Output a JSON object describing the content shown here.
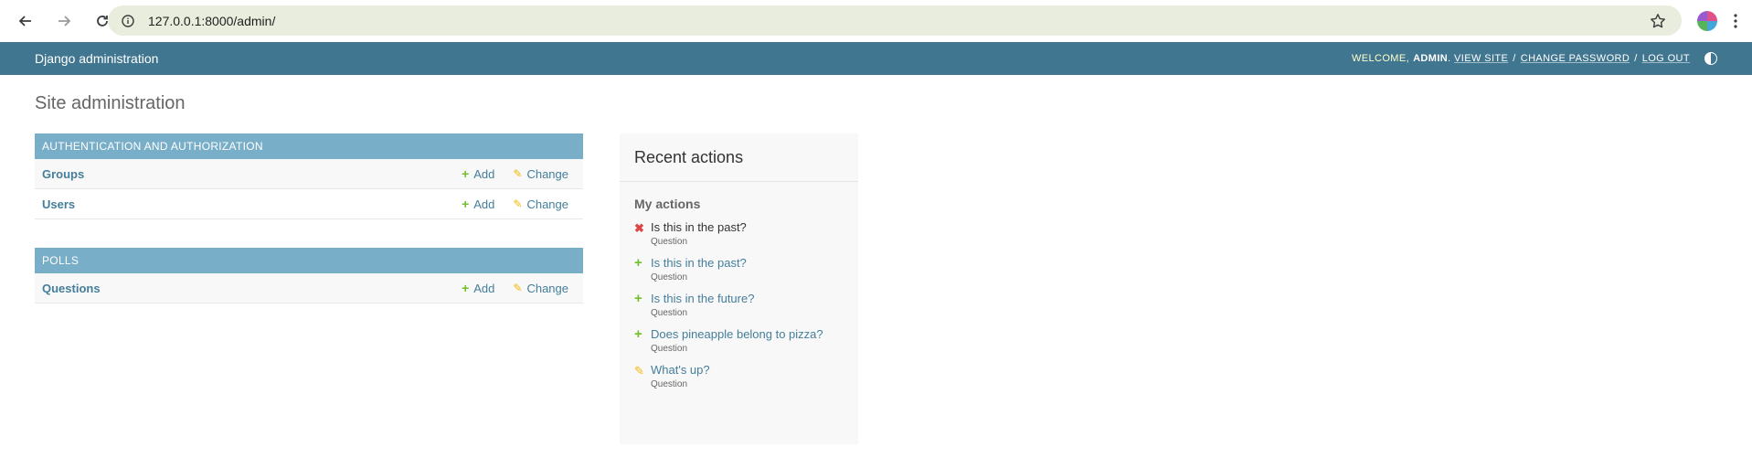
{
  "browser": {
    "url": "127.0.0.1:8000/admin/"
  },
  "header": {
    "branding": "Django administration",
    "welcome": "Welcome,",
    "username": "admin",
    "view_site": "View site",
    "change_password": "Change password",
    "log_out": "Log out"
  },
  "page_title": "Site administration",
  "modules": [
    {
      "caption": "Authentication and Authorization",
      "models": [
        {
          "name": "Groups",
          "add": "Add",
          "change": "Change"
        },
        {
          "name": "Users",
          "add": "Add",
          "change": "Change"
        }
      ]
    },
    {
      "caption": "Polls",
      "models": [
        {
          "name": "Questions",
          "add": "Add",
          "change": "Change"
        }
      ]
    }
  ],
  "recent_actions": {
    "title": "Recent actions",
    "subtitle": "My actions",
    "items": [
      {
        "title": "Is this in the past?",
        "type": "Question",
        "action": "delete"
      },
      {
        "title": "Is this in the past?",
        "type": "Question",
        "action": "add"
      },
      {
        "title": "Is this in the future?",
        "type": "Question",
        "action": "add"
      },
      {
        "title": "Does pineapple belong to pizza?",
        "type": "Question",
        "action": "add"
      },
      {
        "title": "What's up?",
        "type": "Question",
        "action": "change"
      }
    ]
  },
  "colors": {
    "header_bg": "#417690",
    "module_caption": "#79aec8",
    "link": "#447e9b",
    "add_icon": "#70bf2b",
    "change_icon": "#efb80b",
    "delete_icon": "#dd4646"
  }
}
